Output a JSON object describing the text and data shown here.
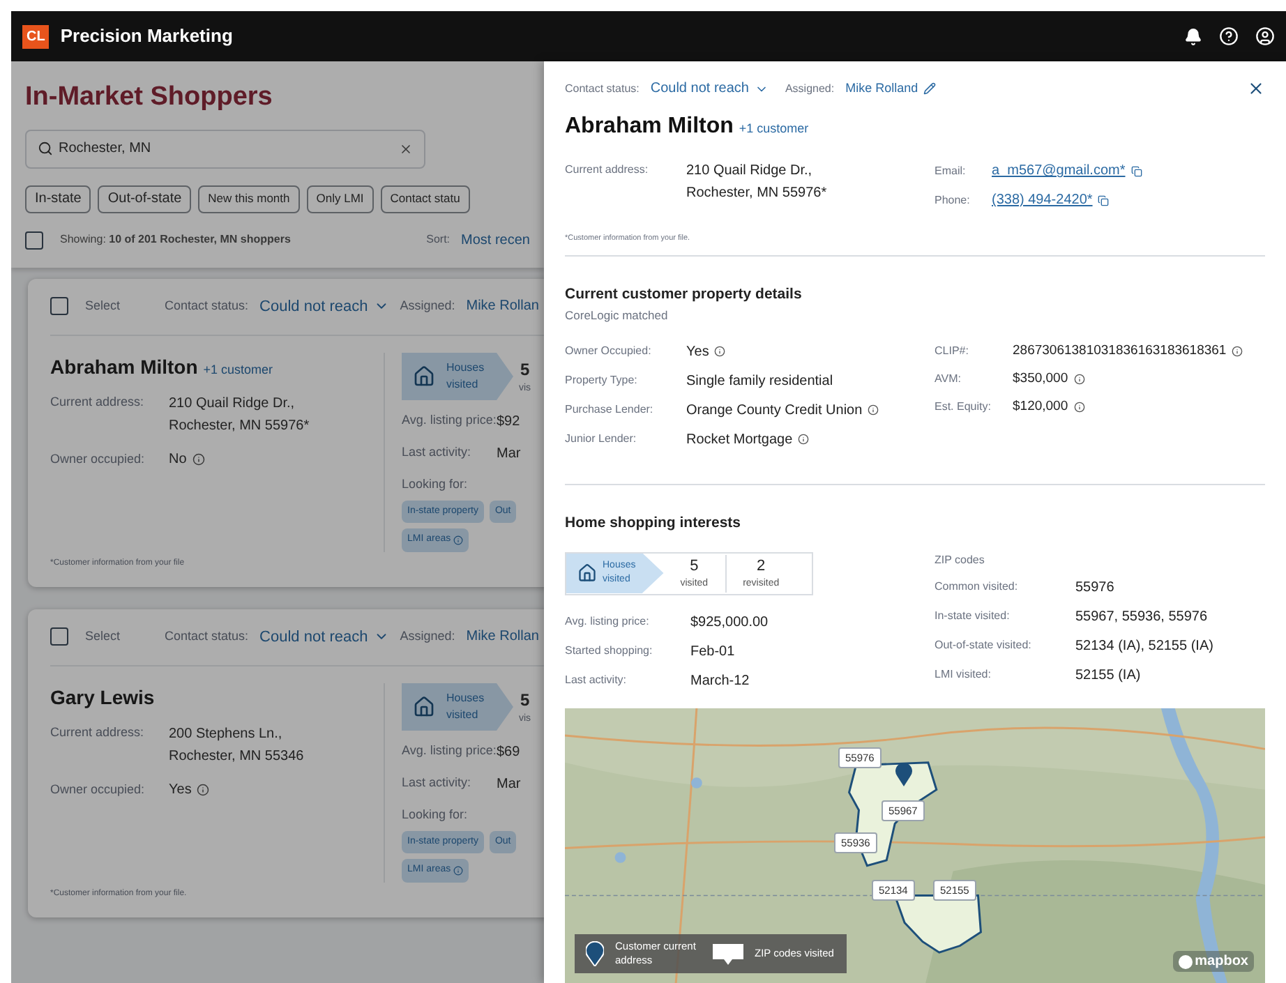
{
  "app": {
    "logo": "CL",
    "title": "Precision Marketing"
  },
  "list": {
    "title": "In-Market Shoppers",
    "search": {
      "value": "Rochester, MN"
    },
    "filters": [
      {
        "label": "In-state"
      },
      {
        "label": "Out-of-state"
      },
      {
        "label": "New this month"
      },
      {
        "label": "Only LMI"
      },
      {
        "label": "Contact statu"
      }
    ],
    "showing": {
      "checked": false,
      "text": "Showing: **10 of 201 Rochester, MN shoppers**"
    },
    "sort_label": "Sort:",
    "sort_value": "Most recen",
    "cards": [
      {
        "checked": false,
        "select_label": "Select",
        "status_label": "Contact status:",
        "status": "Could not reach",
        "assigned_label": "Assigned:",
        "assigned": "Mike Rollan",
        "name": "Abraham Milton",
        "extra": "+1 customer",
        "address_label": "Current address:",
        "address": [
          "210 Quail Ridge Dr.,",
          "Rochester, MN 55976*"
        ],
        "owner_label": "Owner occupied:",
        "owner": "No",
        "houses": [
          "Houses",
          "visited"
        ],
        "count": "5",
        "count_label": "vis",
        "price_label": "Avg. listing price:",
        "price": "$92",
        "activity_label": "Last activity:",
        "activity": "Mar",
        "looking_label": "Looking for:",
        "tags": [
          {
            "label": "In-state property",
            "info": false
          },
          {
            "label": "Out",
            "info": false
          },
          {
            "label": "LMI areas",
            "info": true
          }
        ],
        "footnote": "*Customer information from your file"
      },
      {
        "checked": false,
        "select_label": "Select",
        "status_label": "Contact status:",
        "status": "Could not reach",
        "assigned_label": "Assigned:",
        "assigned": "Mike Rollan",
        "name": "Gary Lewis",
        "address_label": "Current address:",
        "address": [
          "200 Stephens Ln.,",
          "Rochester, MN 55346"
        ],
        "owner_label": "Owner occupied:",
        "owner": "Yes",
        "houses": [
          "Houses",
          "visited"
        ],
        "count": "5",
        "count_label": "vis",
        "price_label": "Avg. listing price:",
        "price": "$69",
        "activity_label": "Last activity:",
        "activity": "Mar",
        "looking_label": "Looking for:",
        "tags": [
          {
            "label": "In-state property",
            "info": false
          },
          {
            "label": "Out",
            "info": false
          },
          {
            "label": "LMI areas",
            "info": true
          }
        ],
        "footnote": "*Customer information from your file."
      }
    ]
  },
  "drawer": {
    "status_label": "Contact status:",
    "status": "Could not reach",
    "assigned_label": "Assigned:",
    "assigned": "Mike Rolland",
    "name": "Abraham Milton",
    "extra": "+1 customer",
    "address_label": "Current address:",
    "address": [
      "210 Quail Ridge Dr.,",
      "Rochester, MN 55976*"
    ],
    "email_label": "Email:",
    "email": "a_m567@gmail.com*",
    "phone_label": "Phone:",
    "phone": "(338) 494-2420*",
    "footnote": "*Customer information from your file.",
    "property": {
      "title": "Current customer property details",
      "subtitle": "CoreLogic matched",
      "left": [
        {
          "label": "Owner Occupied:",
          "value": "Yes",
          "info": true
        },
        {
          "label": "Property Type:",
          "value": "Single family residential",
          "info": false
        },
        {
          "label": "Purchase Lender:",
          "value": "Orange County Credit Union",
          "info": true
        },
        {
          "label": "Junior Lender:",
          "value": "Rocket Mortgage",
          "info": true
        }
      ],
      "right": [
        {
          "label": "CLIP#:",
          "value": "28673061381031836163183618361",
          "info": true
        },
        {
          "label": "AVM:",
          "value": "$350,000",
          "info": true
        },
        {
          "label": "Est. Equity:",
          "value": "$120,000",
          "info": true
        }
      ]
    },
    "shopping": {
      "title": "Home shopping interests",
      "houses": [
        "Houses",
        "visited"
      ],
      "stats": [
        {
          "value": "5",
          "label": "visited"
        },
        {
          "value": "2",
          "label": "revisited"
        }
      ],
      "rows": [
        {
          "label": "Avg. listing price:",
          "value": "$925,000.00"
        },
        {
          "label": "Started shopping:",
          "value": "Feb-01"
        },
        {
          "label": "Last activity:",
          "value": "March-12"
        }
      ],
      "zip_title": "ZIP codes",
      "zip_rows": [
        {
          "label": "Common visited:",
          "value": "55976"
        },
        {
          "label": "In-state visited:",
          "value": "55967, 55936, 55976"
        },
        {
          "label": "Out-of-state visited:",
          "value": "52134 (IA), 52155 (IA)"
        },
        {
          "label": "LMI visited:",
          "value": "52155 (IA)"
        }
      ]
    },
    "map": {
      "kind": "picture",
      "zips": [
        "55976",
        "55967",
        "55936",
        "52134",
        "52155"
      ],
      "legend": [
        {
          "kind": "pin",
          "label": "Customer current address"
        },
        {
          "kind": "zip",
          "label": "ZIP codes visited"
        }
      ],
      "attribution": "mapbox"
    }
  }
}
